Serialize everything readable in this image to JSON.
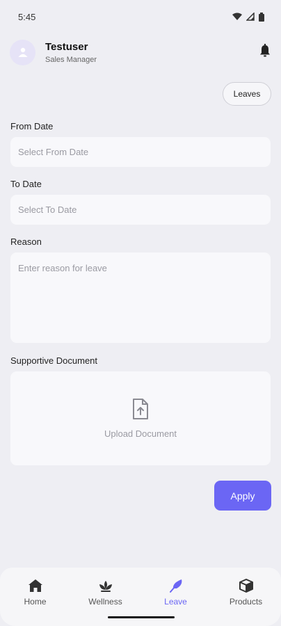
{
  "status": {
    "time": "5:45"
  },
  "user": {
    "name": "Testuser",
    "role": "Sales Manager"
  },
  "leaves_button": "Leaves",
  "form": {
    "from_label": "From Date",
    "from_placeholder": "Select From Date",
    "to_label": "To Date",
    "to_placeholder": "Select To Date",
    "reason_label": "Reason",
    "reason_placeholder": "Enter reason for leave",
    "doc_label": "Supportive Document",
    "upload_text": "Upload Document",
    "apply": "Apply"
  },
  "nav": [
    {
      "label": "Home",
      "icon": "home-icon"
    },
    {
      "label": "Wellness",
      "icon": "lotus-icon"
    },
    {
      "label": "Leave",
      "icon": "feather-icon",
      "active": true
    },
    {
      "label": "Products",
      "icon": "box-icon"
    }
  ],
  "colors": {
    "accent": "#6b66f4",
    "background": "#eeeef3",
    "field": "#f8f8fb"
  }
}
